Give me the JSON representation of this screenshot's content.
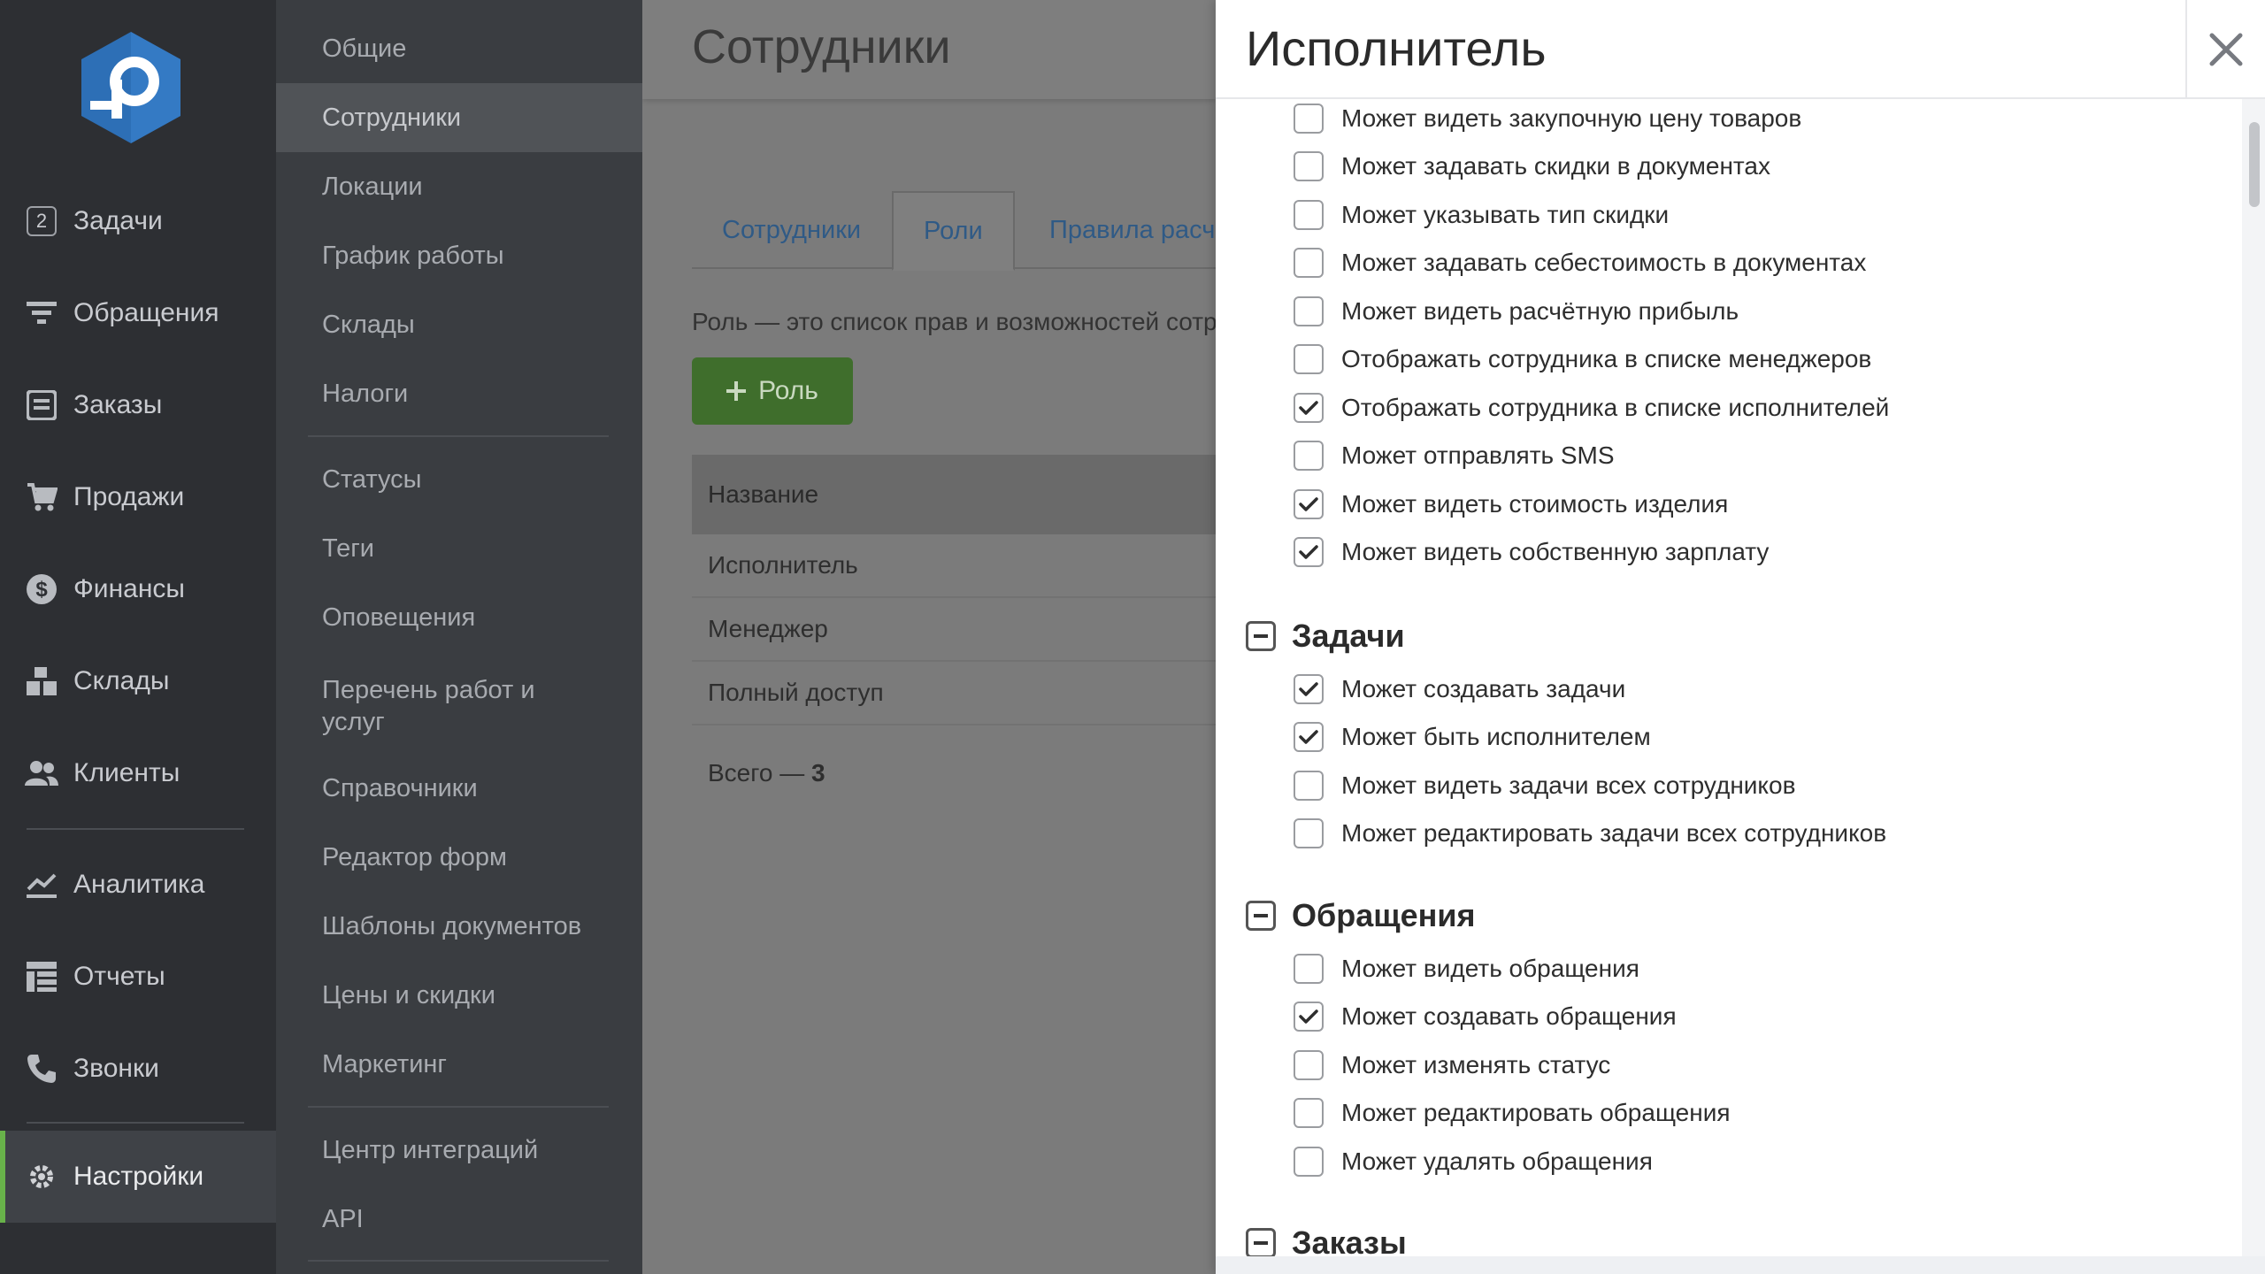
{
  "nav": {
    "items": [
      {
        "id": "tasks",
        "label": "Задачи",
        "badge": "2",
        "icon": "tasks-badge-icon"
      },
      {
        "id": "requests",
        "label": "Обращения",
        "icon": "filter-icon"
      },
      {
        "id": "orders",
        "label": "Заказы",
        "icon": "order-list-icon"
      },
      {
        "id": "sales",
        "label": "Продажи",
        "icon": "cart-icon"
      },
      {
        "id": "finance",
        "label": "Финансы",
        "icon": "dollar-coin-icon"
      },
      {
        "id": "warehouses",
        "label": "Склады",
        "icon": "boxes-icon"
      },
      {
        "id": "clients",
        "label": "Клиенты",
        "icon": "users-icon"
      },
      {
        "id": "analytics",
        "label": "Аналитика",
        "icon": "analytics-chart-icon"
      },
      {
        "id": "reports",
        "label": "Отчеты",
        "icon": "reports-table-icon"
      },
      {
        "id": "calls",
        "label": "Звонки",
        "icon": "phone-icon"
      },
      {
        "id": "settings",
        "label": "Настройки",
        "icon": "settings-gear-icon",
        "active": true
      }
    ]
  },
  "submenu": {
    "items": [
      {
        "label": "Общие"
      },
      {
        "label": "Сотрудники",
        "active": true
      },
      {
        "label": "Локации"
      },
      {
        "label": "График работы"
      },
      {
        "label": "Склады"
      },
      {
        "label": "Налоги"
      },
      {
        "label": "Статусы"
      },
      {
        "label": "Теги"
      },
      {
        "label": "Оповещения"
      },
      {
        "label": "Перечень работ и услуг"
      },
      {
        "label": "Справочники"
      },
      {
        "label": "Редактор форм"
      },
      {
        "label": "Шаблоны документов"
      },
      {
        "label": "Цены и скидки"
      },
      {
        "label": "Маркетинг"
      },
      {
        "label": "Центр интеграций"
      },
      {
        "label": "API"
      }
    ]
  },
  "content": {
    "title": "Сотрудники",
    "tabs": [
      "Сотрудники",
      "Роли",
      "Правила расче"
    ],
    "active_tab": "Роли",
    "description": "Роль — это список прав и возможностей сотру",
    "add_button": "Роль",
    "table": {
      "header": "Название",
      "rows": [
        "Исполнитель",
        "Менеджер",
        "Полный доступ"
      ]
    },
    "total_label": "Всего —",
    "total_value": "3"
  },
  "drawer": {
    "title": "Исполнитель",
    "top_permissions": [
      {
        "label": "Может видеть закупочную цену товаров",
        "checked": false
      },
      {
        "label": "Может задавать скидки в документах",
        "checked": false
      },
      {
        "label": "Может указывать тип скидки",
        "checked": false
      },
      {
        "label": "Может задавать себестоимость в документах",
        "checked": false
      },
      {
        "label": "Может видеть расчётную прибыль",
        "checked": false
      },
      {
        "label": "Отображать сотрудника в списке менеджеров",
        "checked": false
      },
      {
        "label": "Отображать сотрудника в списке исполнителей",
        "checked": true
      },
      {
        "label": "Может отправлять SMS",
        "checked": false
      },
      {
        "label": "Может видеть стоимость изделия",
        "checked": true
      },
      {
        "label": "Может видеть собственную зарплату",
        "checked": true
      }
    ],
    "groups": [
      {
        "title": "Задачи",
        "permissions": [
          {
            "label": "Может создавать задачи",
            "checked": true
          },
          {
            "label": "Может быть исполнителем",
            "checked": true
          },
          {
            "label": "Может видеть задачи всех сотрудников",
            "checked": false
          },
          {
            "label": "Может редактировать задачи всех сотрудников",
            "checked": false
          }
        ]
      },
      {
        "title": "Обращения",
        "permissions": [
          {
            "label": "Может видеть обращения",
            "checked": false
          },
          {
            "label": "Может создавать обращения",
            "checked": true
          },
          {
            "label": "Может изменять статус",
            "checked": false
          },
          {
            "label": "Может редактировать обращения",
            "checked": false
          },
          {
            "label": "Может удалять обращения",
            "checked": false
          }
        ]
      },
      {
        "title": "Заказы",
        "permissions": []
      }
    ]
  },
  "colors": {
    "nav_bg": "#2d2f33",
    "accent_green": "#68b24a",
    "logo_blue": "#2d6fb6",
    "link_blue": "#2f5a86"
  }
}
